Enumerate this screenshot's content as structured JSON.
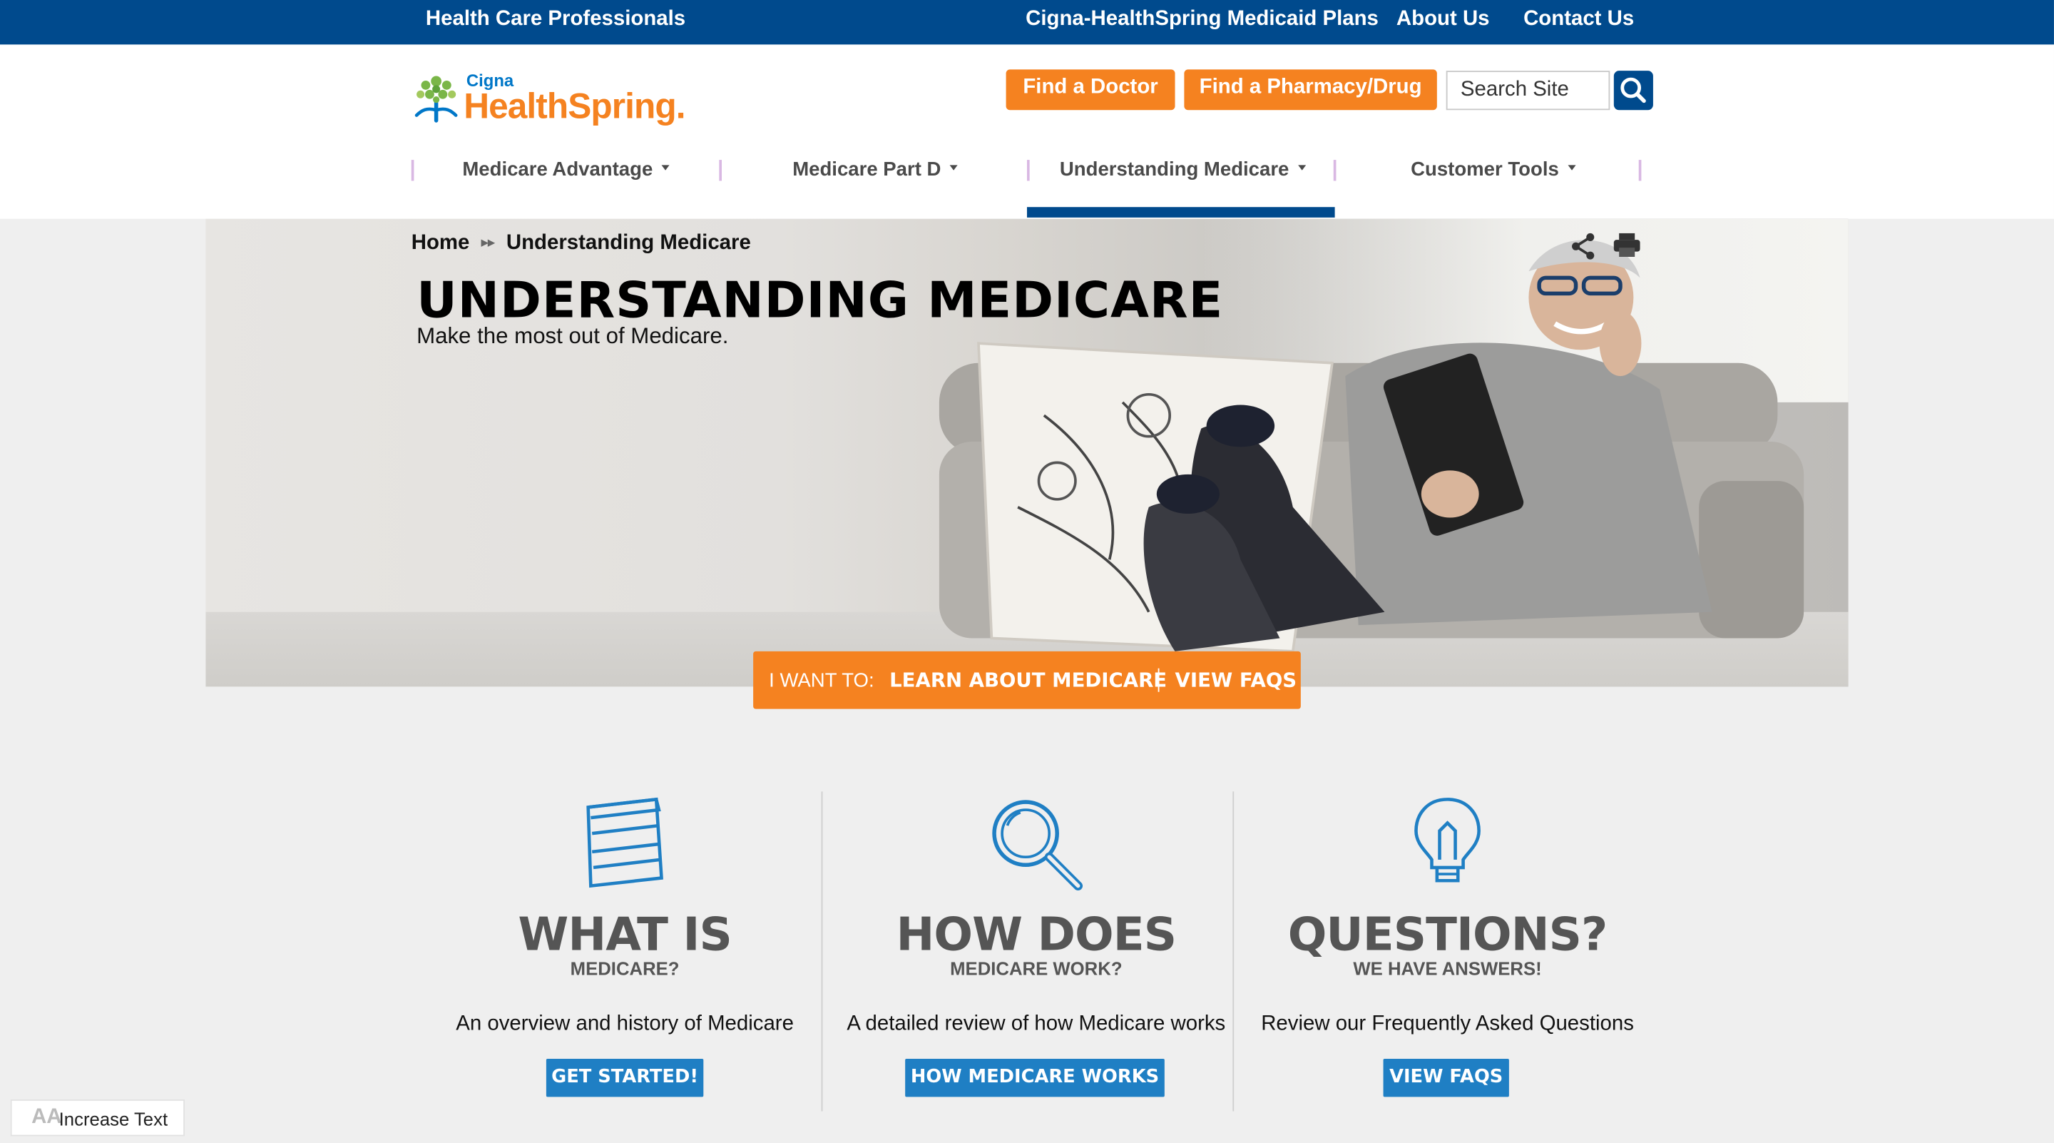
{
  "topbar": {
    "hcp_link": "Health Care Professionals",
    "medicaid_link": "Cigna-HealthSpring Medicaid Plans",
    "about_link": "About Us",
    "contact_link": "Contact Us"
  },
  "logo": {
    "brand_small": "Cigna",
    "brand_main": "HealthSpring."
  },
  "header": {
    "find_doctor": "Find a Doctor",
    "find_pharmacy": "Find a Pharmacy/Drug",
    "search_placeholder": "Search Site",
    "search_icon": "search-icon"
  },
  "nav": {
    "items": [
      {
        "label": "Medicare Advantage"
      },
      {
        "label": "Medicare Part D"
      },
      {
        "label": "Understanding Medicare",
        "active": true
      },
      {
        "label": "Customer Tools"
      }
    ]
  },
  "hero": {
    "breadcrumb": {
      "home": "Home",
      "current": "Understanding Medicare"
    },
    "title": "UNDERSTANDING MEDICARE",
    "subtitle": "Make the most out of Medicare.",
    "icons": [
      "share-icon",
      "print-icon"
    ]
  },
  "iwant": {
    "label": "I WANT TO:",
    "link1": "LEARN ABOUT MEDICARE",
    "link2": "VIEW FAQS"
  },
  "features": [
    {
      "icon": "medicare-card-icon",
      "heading": "WHAT IS",
      "subheading": "MEDICARE?",
      "description": "An overview and history of Medicare",
      "button": "GET STARTED!"
    },
    {
      "icon": "magnifier-icon",
      "heading": "HOW DOES",
      "subheading": "MEDICARE WORK?",
      "description": "A detailed review of how Medicare works",
      "button": "HOW MEDICARE WORKS"
    },
    {
      "icon": "lightbulb-icon",
      "heading": "QUESTIONS?",
      "subheading": "WE HAVE ANSWERS!",
      "description": "Review our Frequently Asked Questions",
      "button": "VIEW FAQS"
    }
  ],
  "accessibility": {
    "increase_text": "Increase Text"
  },
  "colors": {
    "navy": "#004a8d",
    "orange": "#f58220",
    "blue": "#1f7fc4",
    "bg": "#efefef"
  }
}
